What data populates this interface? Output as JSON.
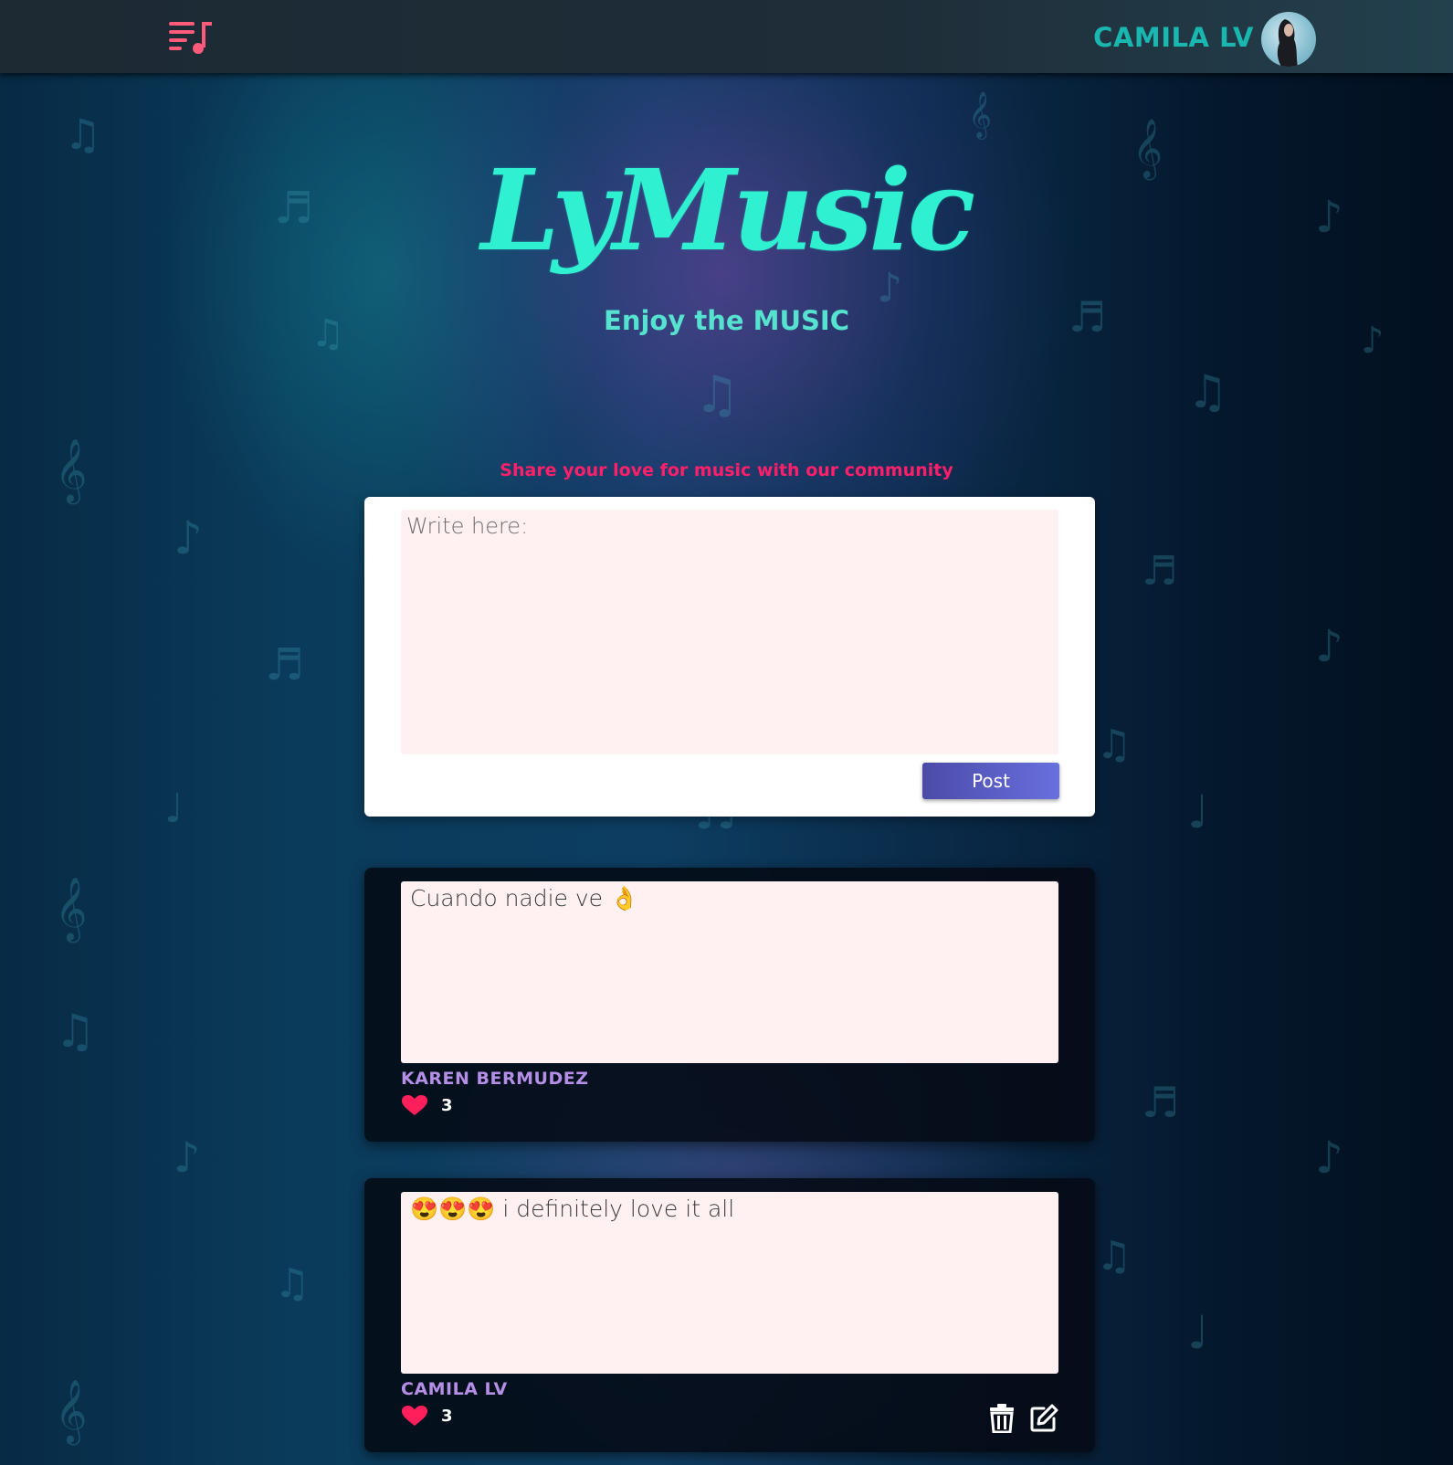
{
  "header": {
    "menu_icon": "playlist-music-icon",
    "user_name": "CAMILA LV",
    "avatar_icon": "user-avatar"
  },
  "hero": {
    "brand": "LyMusic",
    "tagline": "Enjoy the MUSIC"
  },
  "composer": {
    "heading": "Share your love for music with our community",
    "placeholder": "Write here:",
    "value": "",
    "post_label": "Post"
  },
  "posts": [
    {
      "text": "Cuando nadie ve 👌",
      "author": "KAREN BERMUDEZ",
      "likes": "3",
      "like_icon": "heart-icon",
      "owned": false
    },
    {
      "text": "😍😍😍 i definitely love it all",
      "author": "CAMILA LV",
      "likes": "3",
      "like_icon": "heart-icon",
      "owned": true,
      "delete_icon": "trash-icon",
      "edit_icon": "edit-icon"
    }
  ],
  "colors": {
    "accent": "#2ff0d0",
    "username": "#19b7b0",
    "share_heading": "#ff1f6a",
    "author": "#b58ee6",
    "heart": "#ff1f5a",
    "post_button": "#5a5cc4",
    "menu_icon": "#ff5a7a"
  }
}
